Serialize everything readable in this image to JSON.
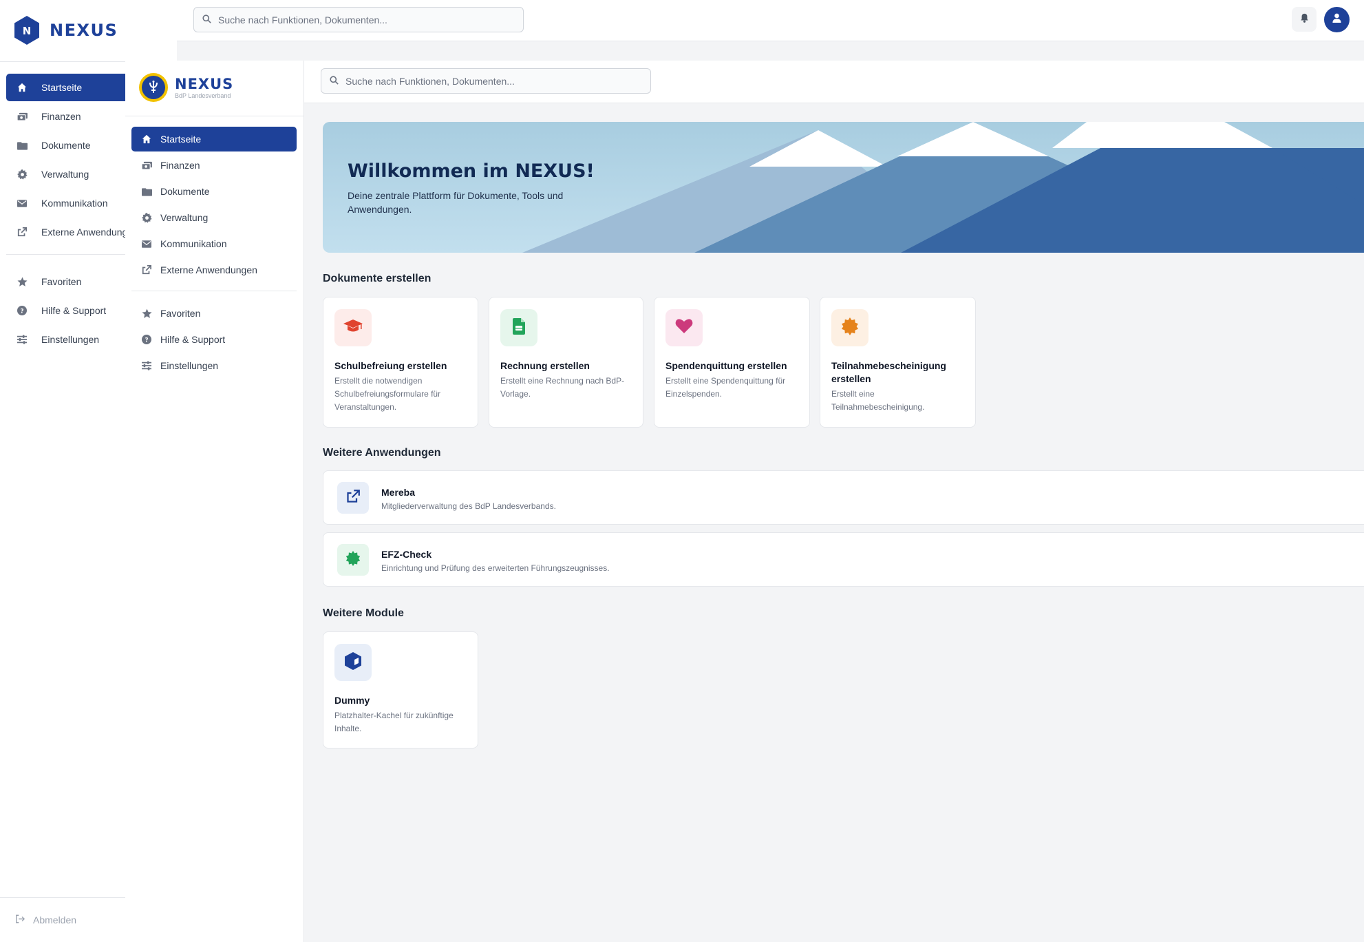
{
  "outer": {
    "logo_text": "NEXUS",
    "logo_letter": "N",
    "search_placeholder": "Suche nach Funktionen, Dokumenten...",
    "nav": [
      {
        "label": "Startseite",
        "icon": "home-icon"
      },
      {
        "label": "Finanzen",
        "icon": "money-icon"
      },
      {
        "label": "Dokumente",
        "icon": "folder-icon"
      },
      {
        "label": "Verwaltung",
        "icon": "gear-icon"
      },
      {
        "label": "Kommunikation",
        "icon": "envelope-icon"
      },
      {
        "label": "Externe Anwendungen",
        "icon": "external-link-icon"
      }
    ],
    "nav_secondary": [
      {
        "label": "Favoriten",
        "icon": "star-icon"
      },
      {
        "label": "Hilfe & Support",
        "icon": "help-icon"
      },
      {
        "label": "Einstellungen",
        "icon": "sliders-icon"
      }
    ],
    "logout_label": "Abmelden"
  },
  "inner": {
    "logo_title": "NEXUS",
    "logo_subtitle": "BdP Landesverband",
    "search_placeholder": "Suche nach Funktionen, Dokumenten...",
    "nav": [
      {
        "label": "Startseite",
        "icon": "home-icon"
      },
      {
        "label": "Finanzen",
        "icon": "money-icon"
      },
      {
        "label": "Dokumente",
        "icon": "folder-icon"
      },
      {
        "label": "Verwaltung",
        "icon": "gear-icon"
      },
      {
        "label": "Kommunikation",
        "icon": "envelope-icon"
      },
      {
        "label": "Externe Anwendungen",
        "icon": "external-link-icon"
      }
    ],
    "nav_secondary": [
      {
        "label": "Favoriten",
        "icon": "star-icon"
      },
      {
        "label": "Hilfe & Support",
        "icon": "help-icon"
      },
      {
        "label": "Einstellungen",
        "icon": "sliders-icon"
      }
    ]
  },
  "hero": {
    "title": "Willkommen im NEXUS!",
    "subtitle": "Deine zentrale Plattform für Dokumente, Tools und Anwendungen."
  },
  "sections": {
    "documents": "Dokumente erstellen",
    "apps": "Weitere Anwendungen",
    "modules": "Weitere Module"
  },
  "document_cards": [
    {
      "title": "Schulbefreiung erstellen",
      "desc": "Erstellt die notwendigen Schulbefreiungsformulare für Veranstaltungen.",
      "icon": "graduation-cap-icon",
      "color": "#e0442f",
      "bg": "#fdecea"
    },
    {
      "title": "Rechnung erstellen",
      "desc": "Erstellt eine Rechnung nach BdP-Vorlage.",
      "icon": "invoice-icon",
      "color": "#22a45a",
      "bg": "#e6f6ec"
    },
    {
      "title": "Spendenquittung erstellen",
      "desc": "Erstellt eine Spendenquittung für Einzelspenden.",
      "icon": "heart-icon",
      "color": "#cc3a7c",
      "bg": "#fbe8f0"
    },
    {
      "title": "Teilnahmebescheinigung erstellen",
      "desc": "Erstellt eine Teilnahmebescheinigung.",
      "icon": "certificate-icon",
      "color": "#e5831c",
      "bg": "#fdf0e3"
    }
  ],
  "apps": [
    {
      "title": "Mereba",
      "desc": "Mitgliederverwaltung des BdP Landesverbands.",
      "icon": "external-link-icon",
      "color": "#1e4199",
      "bg": "#e8eef8"
    },
    {
      "title": "EFZ-Check",
      "desc": "Einrichtung und Prüfung des erweiterten Führungszeugnisses.",
      "icon": "badge-check-icon",
      "color": "#22a45a",
      "bg": "#e6f6ec"
    }
  ],
  "modules": [
    {
      "title": "Dummy",
      "desc": "Platzhalter-Kachel für zukünftige Inhalte.",
      "icon": "cube-icon",
      "color": "#1e4199",
      "bg": "#e8eef8"
    }
  ],
  "colors": {
    "primary": "#1e4199",
    "accent_yellow": "#f2c200"
  }
}
